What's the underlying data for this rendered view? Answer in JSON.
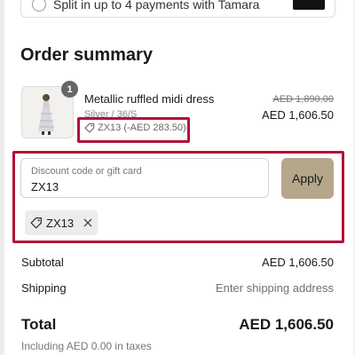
{
  "payment": {
    "option_text": "Split in up to 4 payments with Tamara"
  },
  "order_summary": {
    "title": "Order summary",
    "item": {
      "quantity": "1",
      "name": "Metallic ruffled midi dress",
      "variant": "Silver / 36/S",
      "discount_label": "ZX13 (-AED 283.50)",
      "original_price": "AED 1,890.00",
      "current_price": "AED 1,606.50",
      "thumbnail_icon": "dress-thumbnail"
    },
    "discount": {
      "label": "Discount code or gift card",
      "value": "ZX13",
      "apply_label": "Apply",
      "applied_code": "ZX13"
    },
    "subtotal": {
      "label": "Subtotal",
      "value": "AED 1,606.50"
    },
    "shipping": {
      "label": "Shipping",
      "value": "Enter shipping address"
    },
    "total": {
      "label": "Total",
      "value": "AED 1,606.50"
    },
    "tax_note": "Including AED 0.00 in taxes"
  },
  "colors": {
    "highlight": "#b3123a",
    "apply_button": "#b5a78a",
    "chip_bg": "#ececec"
  }
}
